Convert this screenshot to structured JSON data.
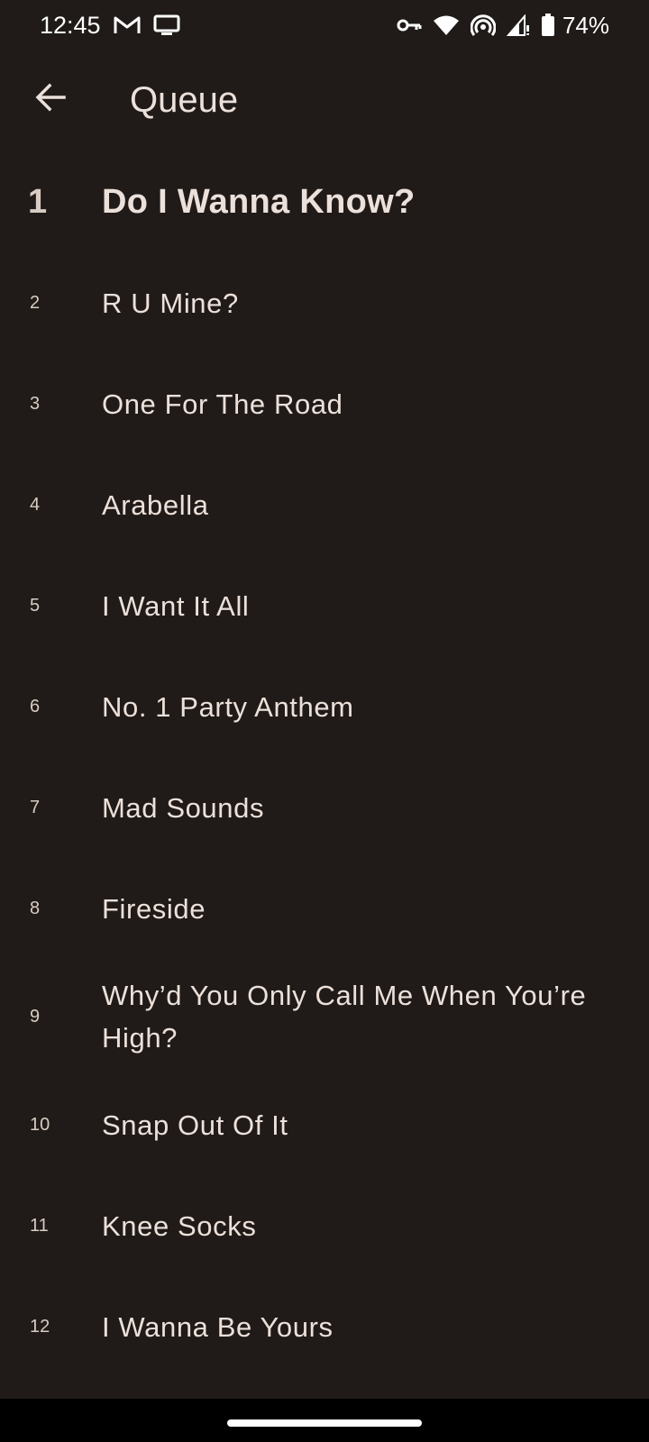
{
  "status_bar": {
    "time": "12:45",
    "battery": "74%",
    "icons": [
      "gmail-icon",
      "cast-screen-icon",
      "vpn-key-icon",
      "wifi-icon",
      "hotspot-icon",
      "signal-icon",
      "battery-icon"
    ]
  },
  "app_bar": {
    "title": "Queue",
    "back_icon": "arrow-back-icon"
  },
  "queue": [
    {
      "num": "1",
      "title": "Do I Wanna Know?",
      "current": true
    },
    {
      "num": "2",
      "title": "R U Mine?"
    },
    {
      "num": "3",
      "title": "One For The Road"
    },
    {
      "num": "4",
      "title": "Arabella"
    },
    {
      "num": "5",
      "title": "I Want It All"
    },
    {
      "num": "6",
      "title": "No. 1 Party Anthem"
    },
    {
      "num": "7",
      "title": "Mad Sounds"
    },
    {
      "num": "8",
      "title": "Fireside"
    },
    {
      "num": "9",
      "title": "Why’d You Only Call Me When You’re High?"
    },
    {
      "num": "10",
      "title": "Snap Out Of It"
    },
    {
      "num": "11",
      "title": "Knee Socks"
    },
    {
      "num": "12",
      "title": "I Wanna Be Yours"
    }
  ],
  "colors": {
    "background": "#201b18",
    "text": "#ece0da",
    "nav_bar": "#000000"
  }
}
